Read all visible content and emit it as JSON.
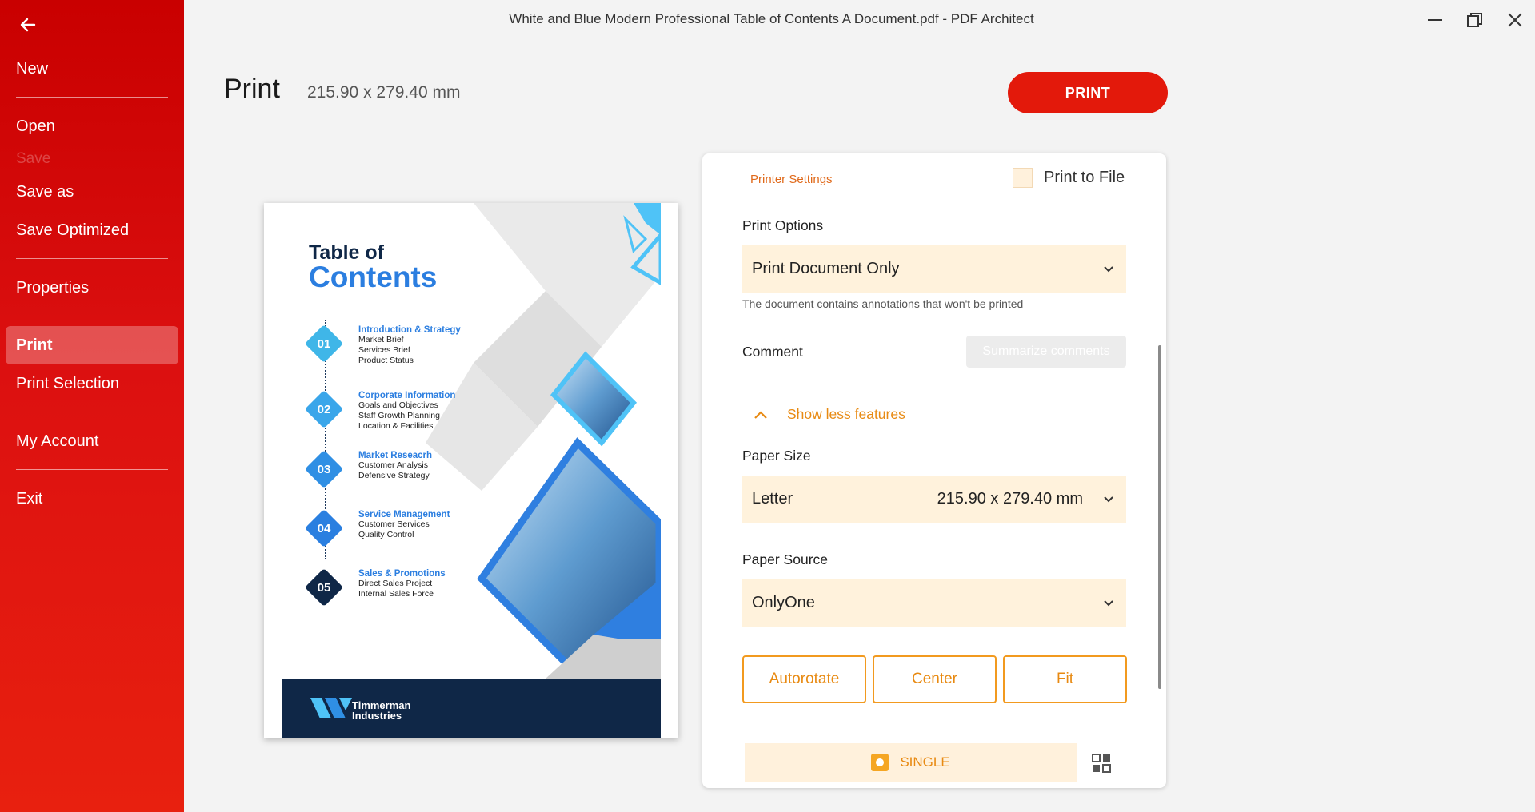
{
  "window": {
    "title": "White and Blue Modern Professional Table of Contents A Document.pdf   -   PDF Architect"
  },
  "sidebar": {
    "items": [
      {
        "label": "New"
      },
      {
        "label": "Open"
      },
      {
        "label": "Save"
      },
      {
        "label": "Save as"
      },
      {
        "label": "Save Optimized"
      },
      {
        "label": "Properties"
      },
      {
        "label": "Print"
      },
      {
        "label": "Print Selection"
      },
      {
        "label": "My Account"
      },
      {
        "label": "Exit"
      }
    ]
  },
  "header": {
    "title": "Print",
    "size": "215.90 x 279.40 mm",
    "print_label": "PRINT"
  },
  "preview": {
    "title_line1": "Table of",
    "title_line2": "Contents",
    "entries": [
      {
        "num": "01",
        "head": "Introduction & Strategy",
        "subs": [
          "Market Brief",
          "Services Brief",
          "Product Status"
        ],
        "color": "#3fb6e8"
      },
      {
        "num": "02",
        "head": "Corporate Information",
        "subs": [
          "Goals and Objectives",
          "Staff Growth Planning",
          "Location & Facilities"
        ],
        "color": "#3aa6ea"
      },
      {
        "num": "03",
        "head": "Market Reseacrh",
        "subs": [
          "Customer Analysis",
          "Defensive Strategy"
        ],
        "color": "#2f8fe4"
      },
      {
        "num": "04",
        "head": "Service Management",
        "subs": [
          "Customer Services",
          "Quality Control"
        ],
        "color": "#2a7fe0"
      },
      {
        "num": "05",
        "head": "Sales & Promotions",
        "subs": [
          "Direct Sales Project",
          "Internal Sales Force"
        ],
        "color": "#0f2747"
      }
    ],
    "brand_line1": "Timmerman",
    "brand_line2": "Industries"
  },
  "panel": {
    "tab_label": "Printer Settings",
    "print_to_file": "Print to File",
    "print_options_label": "Print Options",
    "print_options_value": "Print Document Only",
    "annotation_hint": "The document contains annotations that won't be printed",
    "comment_label": "Comment",
    "summarize_label": "Summarize comments",
    "show_less_label": "Show less features",
    "paper_size_label": "Paper Size",
    "paper_size_value": "Letter",
    "paper_size_dims": "215.90 x 279.40 mm",
    "paper_source_label": "Paper Source",
    "paper_source_value": "OnlyOne",
    "autorotate_label": "Autorotate",
    "center_label": "Center",
    "fit_label": "Fit",
    "single_label": "SINGLE"
  },
  "colors": {
    "accent": "#e3190b",
    "orange": "#e88a12",
    "field_bg": "#fff2dc"
  }
}
